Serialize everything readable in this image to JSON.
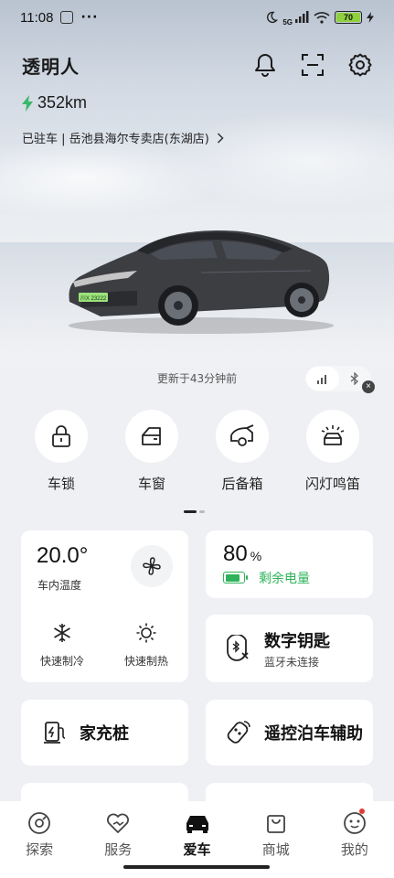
{
  "status_bar": {
    "time": "11:08",
    "more": "···",
    "network": "5G",
    "battery": "70"
  },
  "header": {
    "title": "透明人"
  },
  "vehicle": {
    "range": "352km",
    "location": "已驻车 | 岳池县海尔专卖店(东湖店)",
    "plate": "川X 23222",
    "updated": "更新于43分钟前"
  },
  "controls": [
    {
      "label": "车锁",
      "icon": "lock-icon"
    },
    {
      "label": "车窗",
      "icon": "window-icon"
    },
    {
      "label": "后备箱",
      "icon": "trunk-icon"
    },
    {
      "label": "闪灯鸣笛",
      "icon": "flash-horn-icon"
    }
  ],
  "climate": {
    "temperature": "20.0°",
    "temperature_label": "车内温度",
    "cool_label": "快速制冷",
    "heat_label": "快速制热"
  },
  "battery": {
    "percent": "80",
    "unit": "%",
    "label": "剩余电量",
    "level": 0.8,
    "color": "#2fb35a"
  },
  "digital_key": {
    "title": "数字钥匙",
    "subtitle": "蓝牙未连接"
  },
  "cards": {
    "charger": "家充桩",
    "parking": "遥控泊车辅助"
  },
  "tabs": [
    {
      "label": "探索",
      "icon": "explore-icon"
    },
    {
      "label": "服务",
      "icon": "service-icon"
    },
    {
      "label": "爱车",
      "icon": "car-icon",
      "active": true
    },
    {
      "label": "商城",
      "icon": "shop-icon"
    },
    {
      "label": "我的",
      "icon": "profile-icon"
    }
  ]
}
